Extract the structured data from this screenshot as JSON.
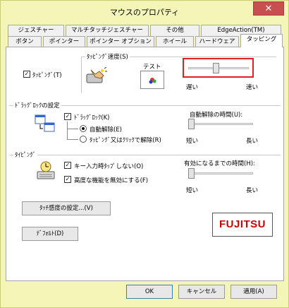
{
  "window": {
    "title": "マウスのプロパティ",
    "close_glyph": "✕"
  },
  "tabs_row1": [
    {
      "label": "ジェスチャー"
    },
    {
      "label": "マルチタッチジェスチャー"
    },
    {
      "label": "その他"
    },
    {
      "label": "EdgeAction(TM)"
    }
  ],
  "tabs_row2": [
    {
      "label": "ボタン"
    },
    {
      "label": "ポインター"
    },
    {
      "label": "ポインター オプション"
    },
    {
      "label": "ホイール"
    },
    {
      "label": "ハードウェア"
    },
    {
      "label": "タッピング"
    }
  ],
  "tapping": {
    "enable_label": "ﾀｯﾋﾟﾝｸﾞ(T)",
    "enable_checked": true,
    "speed_label": "ﾀｯﾋﾟﾝｸﾞ速度(S)",
    "test_label": "テスト",
    "slow_label": "遅い",
    "fast_label": "速い",
    "speed_value_fraction": 0.45
  },
  "drag_lock": {
    "group_label": "ﾄﾞﾗｯｸﾞﾛｯｸの設定",
    "enable_label": "ﾄﾞﾗｯｸﾞﾛｯｸ(K)",
    "enable_checked": true,
    "auto_release_label": "自動解除(E)",
    "tap_release_label": "ﾀｯﾋﾟﾝｸﾞ又はｸﾘｯｸで解除(R)",
    "auto_release_selected": true,
    "time_label": "自動解除の時間(U):",
    "short_label": "短い",
    "long_label": "長い",
    "time_value_fraction": 0.0
  },
  "typing": {
    "group_label": "ﾀｲﾋﾟﾝｸﾞ",
    "keyinput_label": "キー入力時ﾀｯﾌﾟしない(O)",
    "keyinput_checked": true,
    "advanced_label": "高度な機能を無効にする(F)",
    "advanced_checked": true,
    "time_label": "有効になるまでの時間(H):",
    "short_label": "短い",
    "long_label": "長い",
    "time_value_fraction": 0.0
  },
  "buttons": {
    "sensitivity": "ﾀｯﾁ感度の設定...(V)",
    "default": "ﾃﾞﾌｫﾙﾄ(D)",
    "ok": "OK",
    "cancel": "キャンセル",
    "apply": "適用(A)"
  },
  "logo": {
    "text": "FUJITSU"
  },
  "colors": {
    "highlight_red": "#e02020",
    "logo_red": "#cc0000"
  }
}
